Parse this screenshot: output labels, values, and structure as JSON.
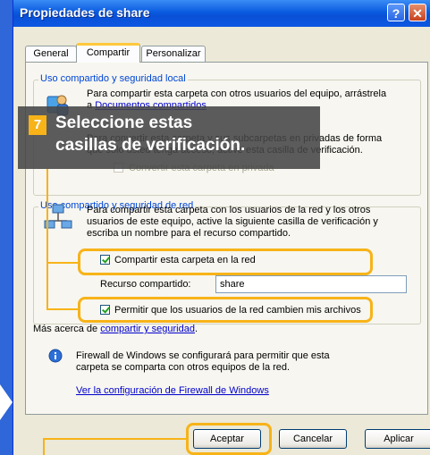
{
  "window": {
    "title": "Propiedades de share",
    "help_glyph": "?",
    "close_glyph": "✕"
  },
  "tabs": [
    {
      "label": "General"
    },
    {
      "label": "Compartir"
    },
    {
      "label": "Personalizar"
    }
  ],
  "local_group": {
    "title": "Uso compartido y seguridad local",
    "text1": "Para compartir esta carpeta con otros usuarios del equipo, arrástrela",
    "text2_prefix": "a ",
    "text2_link": "Documentos compartidos",
    "text3": "Para convertir esta carpeta y sus subcarpetas en privadas de forma",
    "text4": "que sólo usted tenga acceso, active esta casilla de verificación.",
    "private_label": "Convertir esta carpeta en privada"
  },
  "net_group": {
    "title": "Uso compartido y seguridad de red",
    "text1": "Para compartir esta carpeta con los usuarios de la red y los otros",
    "text2": "usuarios de este equipo, active la siguiente casilla de verificación y",
    "text3": "escriba un nombre para el recurso compartido.",
    "share_label": "Compartir esta carpeta en la red",
    "share_checked": true,
    "resource_label": "Recurso compartido:",
    "resource_value": "share",
    "allow_label": "Permitir que los usuarios de la red cambien mis archivos",
    "allow_checked": true
  },
  "more_info": {
    "prefix": "Más acerca de ",
    "link": "compartir y seguridad",
    "suffix": "."
  },
  "firewall": {
    "text1": "Firewall de Windows se configurará para permitir que esta",
    "text2": "carpeta se comparta con otros equipos de la red.",
    "link": "Ver la configuración de Firewall de Windows"
  },
  "buttons": {
    "ok": "Aceptar",
    "cancel": "Cancelar",
    "apply": "Aplicar"
  },
  "callout": {
    "number": "7",
    "line1": "Seleccione estas",
    "line2": "casillas de verificación."
  },
  "colors": {
    "accent": "#f7b318",
    "title_bar": "#0a5be0",
    "group_title": "#0046d5"
  }
}
